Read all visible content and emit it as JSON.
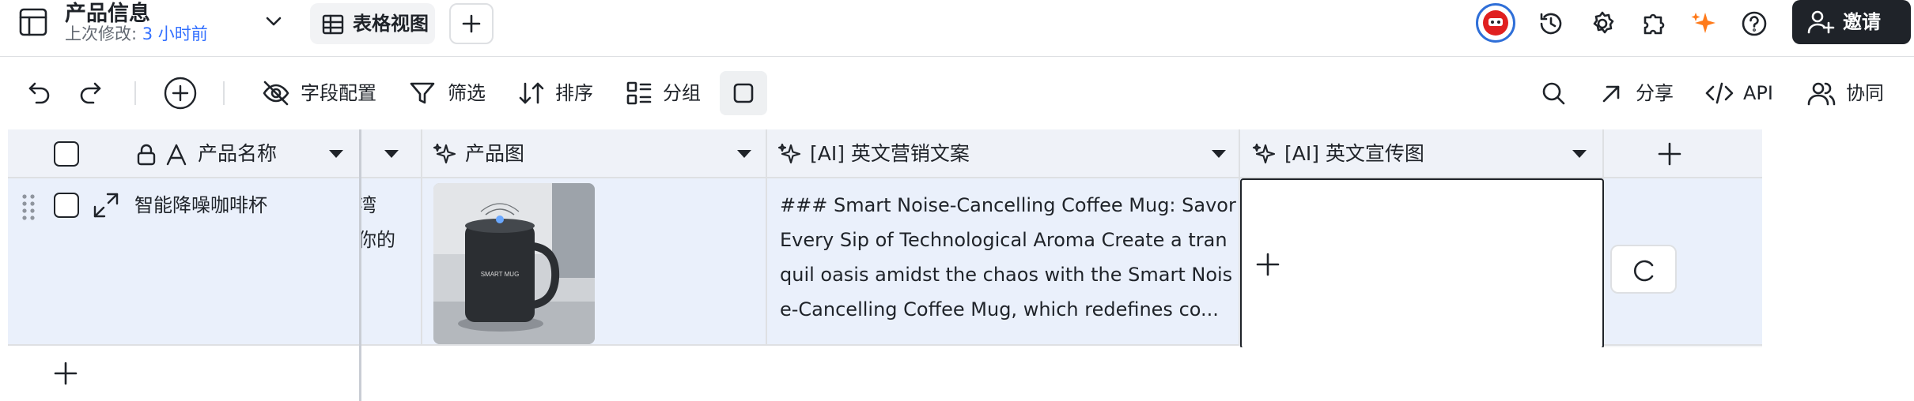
{
  "header": {
    "title": "产品信息",
    "last_modified_label": "上次修改:",
    "last_modified_value": "3 小时前",
    "view_name": "表格视图",
    "invite_label": "邀请"
  },
  "toolbar": {
    "field_config_label": "字段配置",
    "filter_label": "筛选",
    "sort_label": "排序",
    "group_label": "分组",
    "share_label": "分享",
    "api_label": "API",
    "collab_label": "协同"
  },
  "table": {
    "columns": [
      {
        "label": "产品名称"
      },
      {
        "label": ""
      },
      {
        "label": "产品图"
      },
      {
        "label": "[AI] 英文营销文案"
      },
      {
        "label": "[AI] 英文宣传图"
      }
    ],
    "rows": [
      {
        "name": "智能降噪咖啡杯",
        "hidden_col_line1": "湾",
        "hidden_col_line2": "你的",
        "image_mug_text": "SMART MUG",
        "marketing_copy": "### Smart Noise-Cancelling Coffee Mug: Savor  Every Sip of Technological Aroma  Create a tranquil oasis amidst the chaos with the Smart Noise-Cancelling Coffee Mug, which redefines co..."
      }
    ]
  },
  "colors": {
    "accent": "#3370ff",
    "header_bg": "#eff2f8",
    "row_bg": "#eaf0fb",
    "ai_sparkle": "#ff7a1a"
  },
  "icons": {
    "table": "table-icon",
    "history": "history-icon",
    "settings": "gear-icon",
    "plugin": "puzzle-icon",
    "ai": "sparkle-icon",
    "help": "help-icon"
  }
}
